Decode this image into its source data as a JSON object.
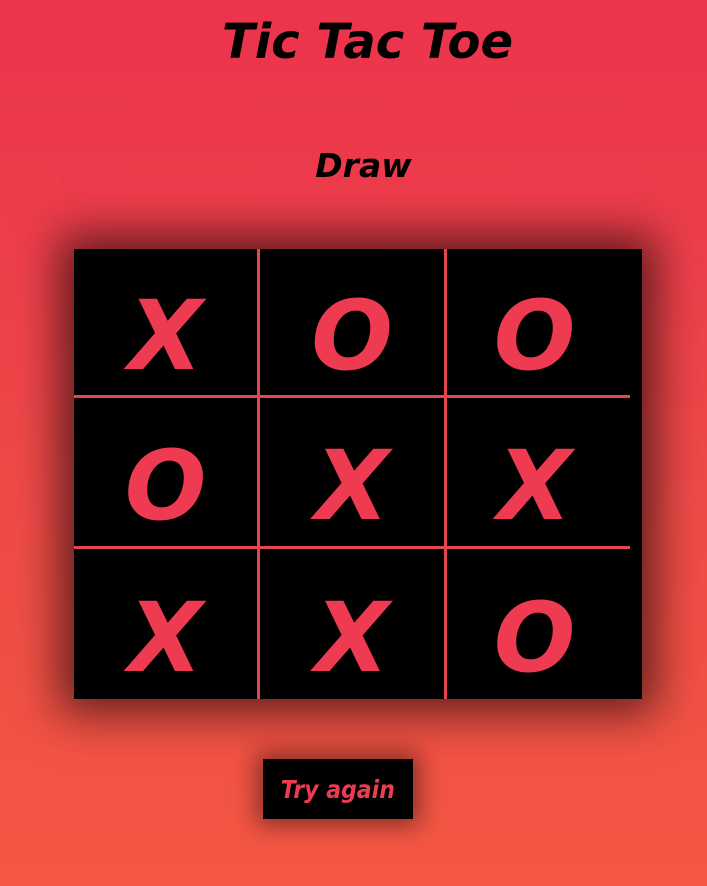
{
  "title": "Tic Tac Toe",
  "status": "Draw",
  "board": [
    [
      "X",
      "O",
      "O"
    ],
    [
      "O",
      "X",
      "X"
    ],
    [
      "X",
      "X",
      "O"
    ]
  ],
  "retry_label": "Try again",
  "colors": {
    "background_top": "#ec334c",
    "background_bottom": "#f35742",
    "mark": "#ee3b52",
    "board": "#000000",
    "grid_line": "#e5454d"
  }
}
